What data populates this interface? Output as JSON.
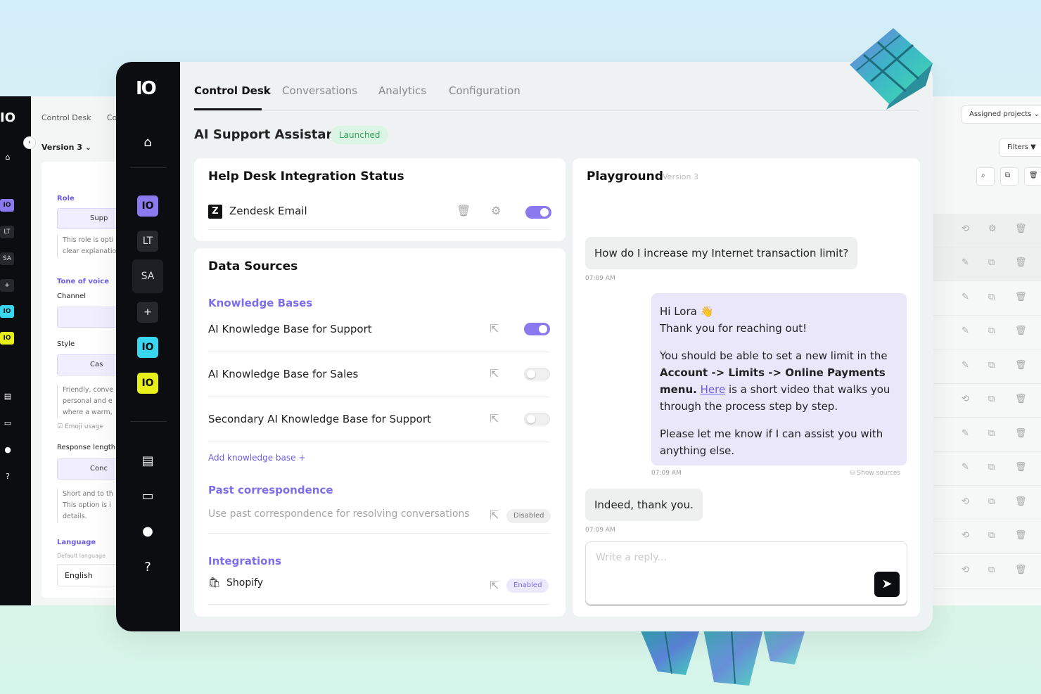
{
  "back_left": {
    "logo": "IO",
    "tab_control_desk": "Control Desk",
    "tab_partial": "Co",
    "version": "Version 3",
    "chips": [
      "LT",
      "SA",
      "+"
    ],
    "role_label": "Role",
    "role_value": "Supp",
    "role_note": [
      "This role is opti",
      "clear explanatio"
    ],
    "tone_label": "Tone of voice",
    "channel_label": "Channel",
    "style_label": "Style",
    "style_value": "Cas",
    "style_note": [
      "Friendly, conve",
      "personal and e",
      "where a warm,"
    ],
    "emoji_label": "Emoji usage",
    "response_label": "Response length",
    "response_value": "Conc",
    "response_note": [
      "Short and to th",
      "This option is i",
      "details."
    ],
    "language_label": "Language",
    "default_language_label": "Default language",
    "language_value": "English"
  },
  "back_right": {
    "assigned_projects": "Assigned projects",
    "filters": "Filters"
  },
  "main": {
    "logo": "IO",
    "tabs": [
      "Control Desk",
      "Conversations",
      "Analytics",
      "Configuration"
    ],
    "chips": [
      "LT",
      "SA",
      "+"
    ],
    "title": "AI Support Assistant",
    "status_badge": "Launched"
  },
  "integration_card": {
    "title": "Help Desk Integration Status",
    "item": "Zendesk Email",
    "toggle_on": true
  },
  "data_sources": {
    "title": "Data Sources",
    "knowledge_bases_heading": "Knowledge Bases",
    "knowledge_bases": [
      {
        "label": "AI Knowledge Base for Support",
        "enabled": true
      },
      {
        "label": "AI Knowledge Base for Sales",
        "enabled": false
      },
      {
        "label": "Secondary AI Knowledge Base for Support",
        "enabled": false
      }
    ],
    "add_knowledge_base": "Add knowledge base  +",
    "past_correspondence_heading": "Past correspondence",
    "past_correspondence_text": "Use past correspondence for resolving conversations",
    "past_correspondence_status": "Disabled",
    "integrations_heading": "Integrations",
    "integration_item": "Shopify",
    "integration_status": "Enabled"
  },
  "playground": {
    "title": "Playground",
    "version": "Version 3",
    "user_message_1": "How do I increase my Internet transaction limit?",
    "time_1": "07:09 AM",
    "bot_greeting": "Hi Lora 👋",
    "bot_line_2": "Thank you for reaching out!",
    "bot_p2_start": "You should be able to set a new limit in the ",
    "bot_p2_bold": "Account -> Limits -> Online Payments menu.",
    "bot_p2_link": "Here",
    "bot_p2_end": " is a short video that walks you through the process step by step.",
    "bot_p3": "Please let me know if I can assist you with anything else.",
    "time_2": "07:09 AM",
    "show_sources": "Show sources",
    "user_message_2": "Indeed, thank you.",
    "time_3": "07:09 AM",
    "reply_placeholder": "Write a reply..."
  },
  "colors": {
    "accent": "#7d6ee9",
    "chip_purple": "#8a79ef",
    "chip_cyan": "#39d6f0",
    "chip_yellow": "#e8f01a",
    "launched_bg": "#dcf4e3",
    "launched_text": "#33a259"
  }
}
